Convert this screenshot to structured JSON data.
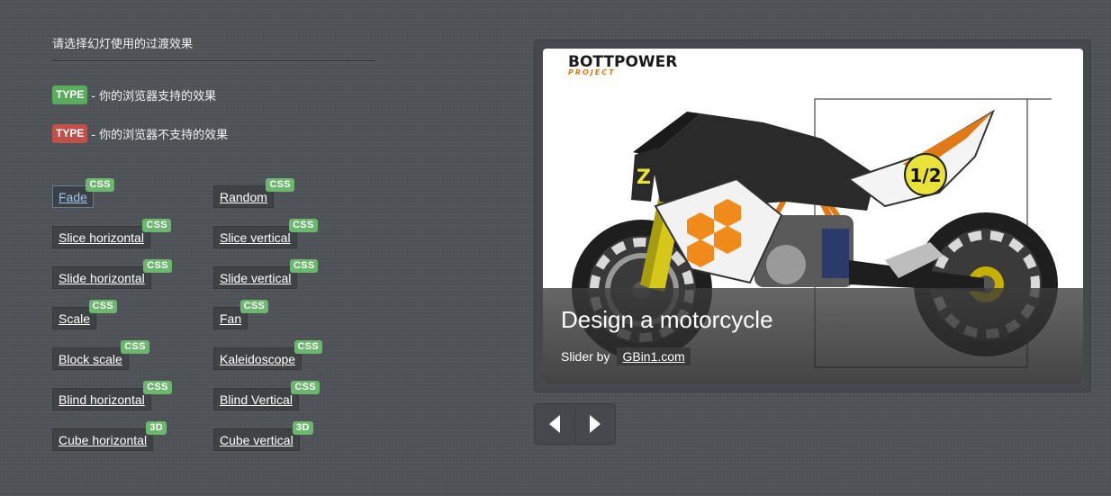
{
  "left": {
    "heading": "请选择幻灯使用的过渡效果",
    "legend": [
      {
        "tag": "TYPE",
        "text": "- 你的浏览器支持的效果",
        "color": "#5bab5e"
      },
      {
        "tag": "TYPE",
        "text": "- 你的浏览器不支持的效果",
        "color": "#c0504a"
      }
    ]
  },
  "effects": [
    {
      "label": "Fade",
      "badge": "CSS",
      "active": true
    },
    {
      "label": "Random",
      "badge": "CSS"
    },
    {
      "label": "Slice horizontal",
      "badge": "CSS"
    },
    {
      "label": "Slice vertical",
      "badge": "CSS"
    },
    {
      "label": "Slide horizontal",
      "badge": "CSS"
    },
    {
      "label": "Slide vertical",
      "badge": "CSS"
    },
    {
      "label": "Scale",
      "badge": "CSS"
    },
    {
      "label": "Fan",
      "badge": "CSS"
    },
    {
      "label": "Block scale",
      "badge": "CSS"
    },
    {
      "label": "Kaleidoscope",
      "badge": "CSS"
    },
    {
      "label": "Blind horizontal",
      "badge": "CSS"
    },
    {
      "label": "Blind Vertical",
      "badge": "CSS"
    },
    {
      "label": "Cube horizontal",
      "badge": "3D"
    },
    {
      "label": "Cube vertical",
      "badge": "3D"
    }
  ],
  "slide": {
    "brand_top": "BOTTPOWER",
    "brand_sub": "PROJECT",
    "number_plate": "1/2",
    "caption_title": "Design a motorcycle",
    "caption_by": "Slider by",
    "caption_link": "GBin1.com",
    "watermark": "anima"
  },
  "nav": {
    "prev_icon": "chevron-left-icon",
    "next_icon": "chevron-right-icon"
  }
}
